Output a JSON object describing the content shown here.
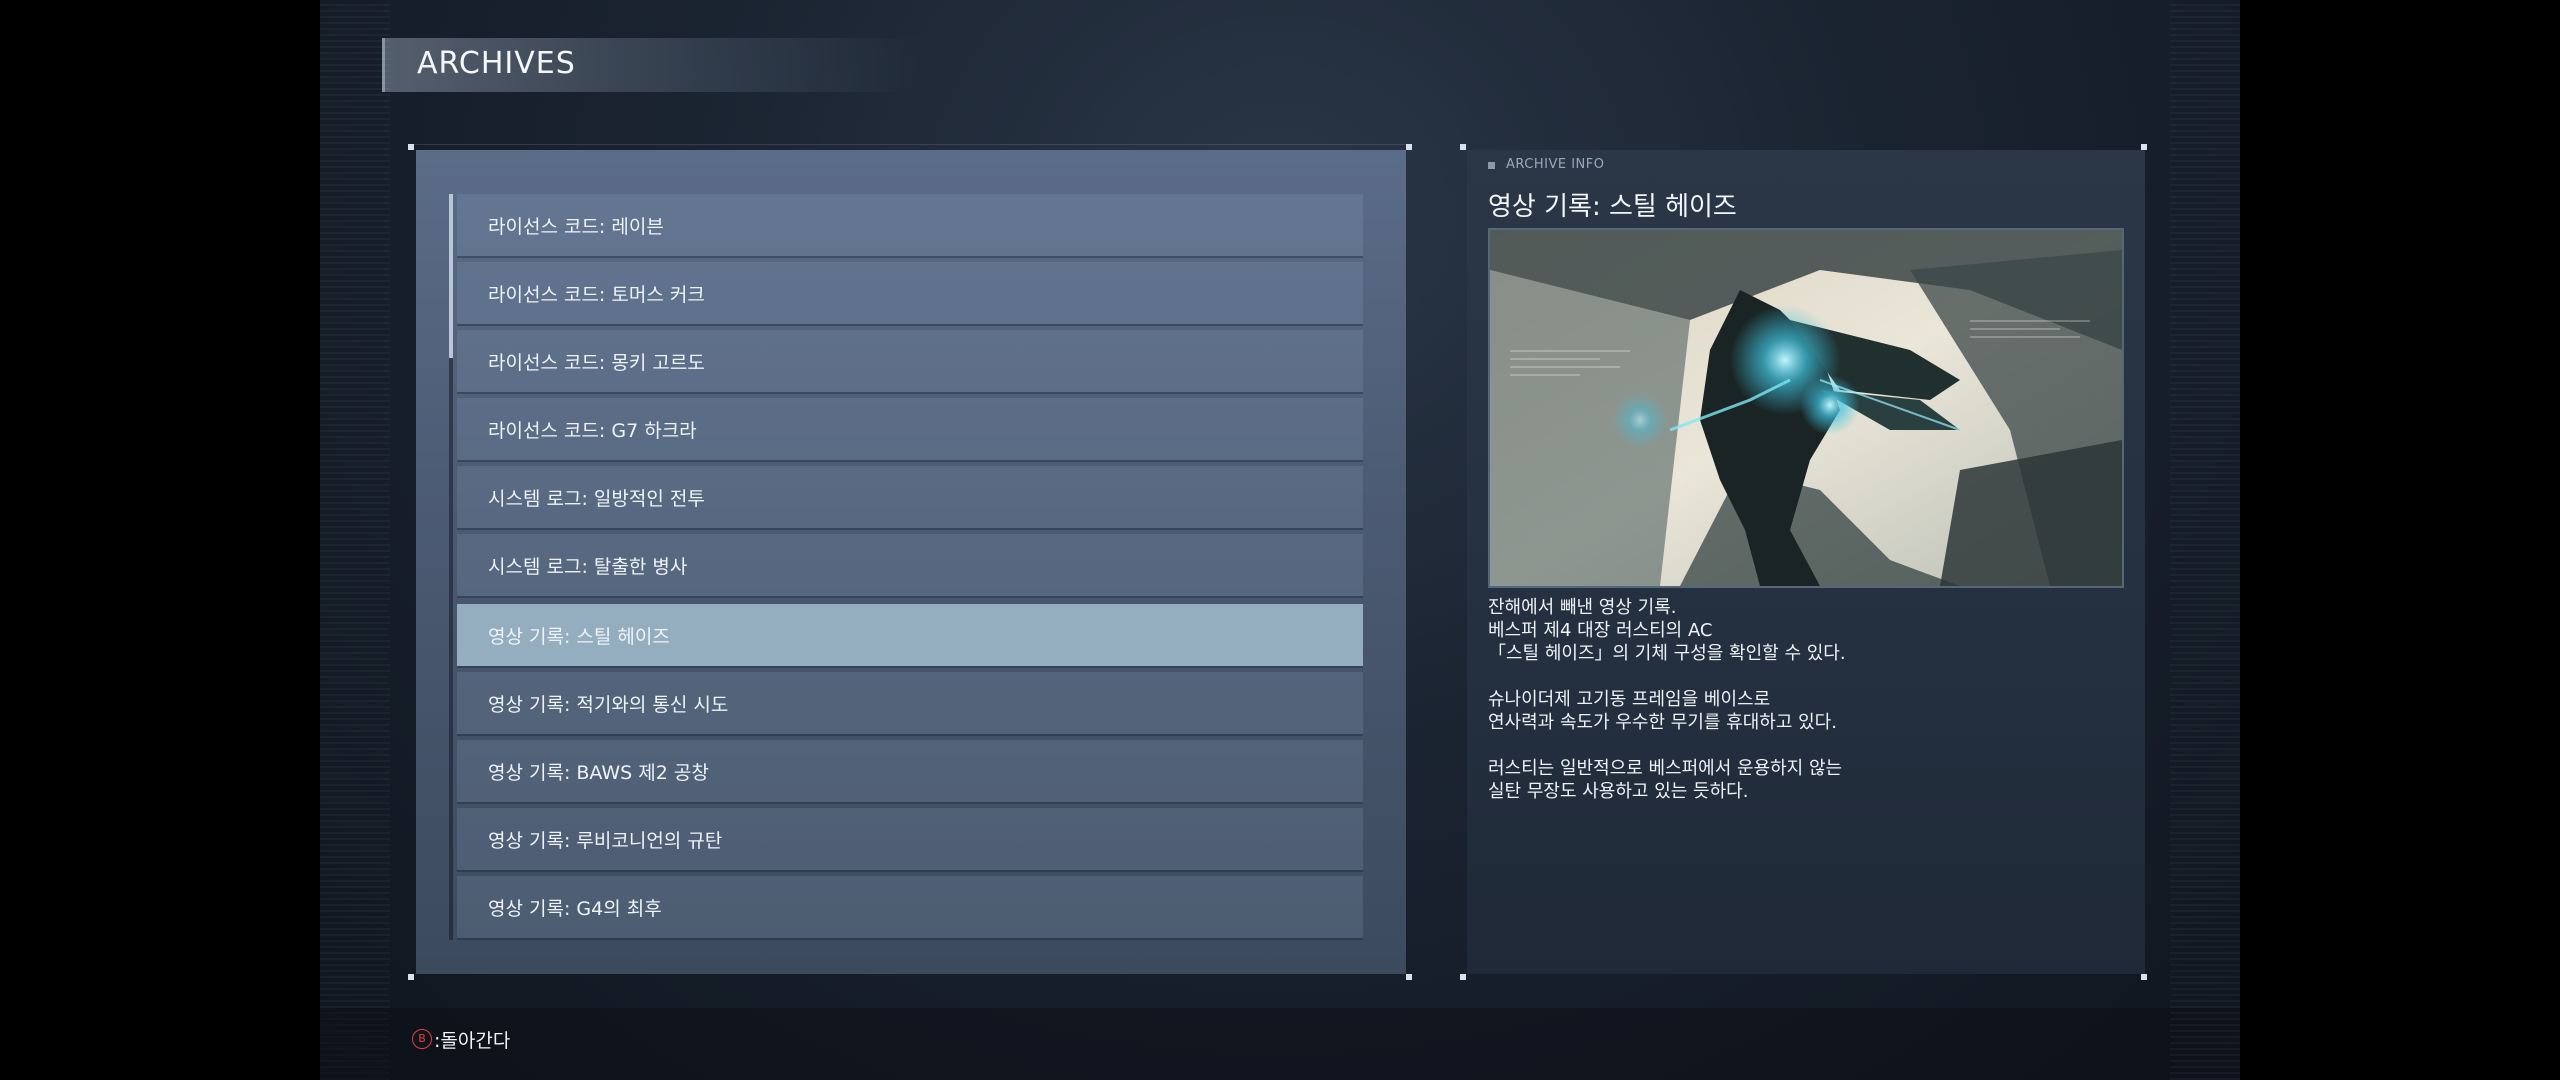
{
  "header": {
    "title": "ARCHIVES"
  },
  "list": {
    "items": [
      {
        "label": "라이선스 코드: 레이븐",
        "selected": false
      },
      {
        "label": "라이선스 코드: 토머스 커크",
        "selected": false
      },
      {
        "label": "라이선스 코드: 몽키 고르도",
        "selected": false
      },
      {
        "label": "라이선스 코드: G7 하크라",
        "selected": false
      },
      {
        "label": "시스템 로그: 일방적인 전투",
        "selected": false
      },
      {
        "label": "시스템 로그: 탈출한 병사",
        "selected": false
      },
      {
        "label": "영상 기록: 스틸 헤이즈",
        "selected": true
      },
      {
        "label": "영상 기록: 적기와의 통신 시도",
        "selected": false
      },
      {
        "label": "영상 기록: BAWS 제2 공창",
        "selected": false
      },
      {
        "label": "영상 기록: 루비코니언의 규탄",
        "selected": false
      },
      {
        "label": "영상 기록: G4의 최후",
        "selected": false
      }
    ]
  },
  "info": {
    "tag": "ARCHIVE INFO",
    "title": "영상 기록: 스틸 헤이즈",
    "description": {
      "line1": "잔해에서 빼낸 영상 기록.",
      "line2": "베스퍼 제4 대장 러스티의 AC",
      "line3": "「스틸 헤이즈」의 기체 구성을 확인할 수 있다.",
      "line4": "슈나이더제 고기동 프레임을 베이스로",
      "line5": "연사력과 속도가 우수한 무기를 휴대하고 있다.",
      "line6": "러스티는 일반적으로 베스퍼에서 운용하지 않는",
      "line7": "실탄 무장도 사용하고 있는 듯하다."
    }
  },
  "footer": {
    "back_button_glyph": "B",
    "back_label": ":돌아간다"
  },
  "colors": {
    "selected_row": "#94aec0",
    "back_icon": "#e04040"
  }
}
